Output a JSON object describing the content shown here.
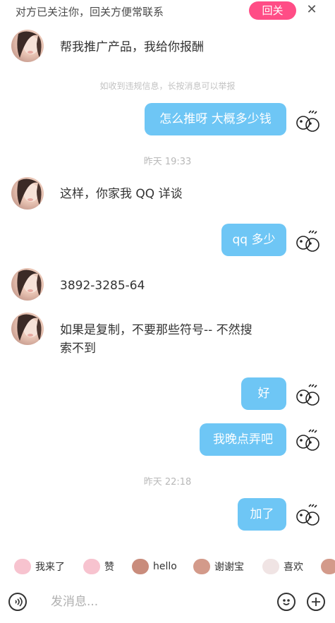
{
  "topbar": {
    "notice": "对方已关注你，回关方便常联系",
    "follow_button": "回关",
    "close_icon": "close-icon"
  },
  "messages": {
    "m1_text": "帮我推广产品，我给你报酬",
    "hint": "如收到违规信息，长按消息可以举报",
    "m2_text": "怎么推呀 大概多少钱",
    "ts1": "昨天 19:33",
    "m3_text": "这样，你家我 QQ 详谈",
    "m4_text": "qq 多少",
    "m5_text": "3892-3285-64",
    "m6_line1": "如果是复制，不要那些符号--   不然搜",
    "m6_line2": "索不到",
    "m7_text": "好",
    "m8_text": "我晚点弄吧",
    "ts2": "昨天 22:18",
    "m9_text": "加了"
  },
  "quick_replies": [
    {
      "label": "我来了",
      "icon": "pig-sticker-icon"
    },
    {
      "label": "赞",
      "icon": "pig-sticker-icon"
    },
    {
      "label": "hello",
      "icon": "monkey-sticker-icon"
    },
    {
      "label": "谢谢宝",
      "icon": "monkey-sticker-icon"
    },
    {
      "label": "喜欢",
      "icon": "rabbit-sticker-icon"
    }
  ],
  "input": {
    "placeholder": "发消息...",
    "value": ""
  },
  "colors": {
    "accent_pink": "#ff4d86",
    "bubble_blue": "#6ec6f5"
  }
}
